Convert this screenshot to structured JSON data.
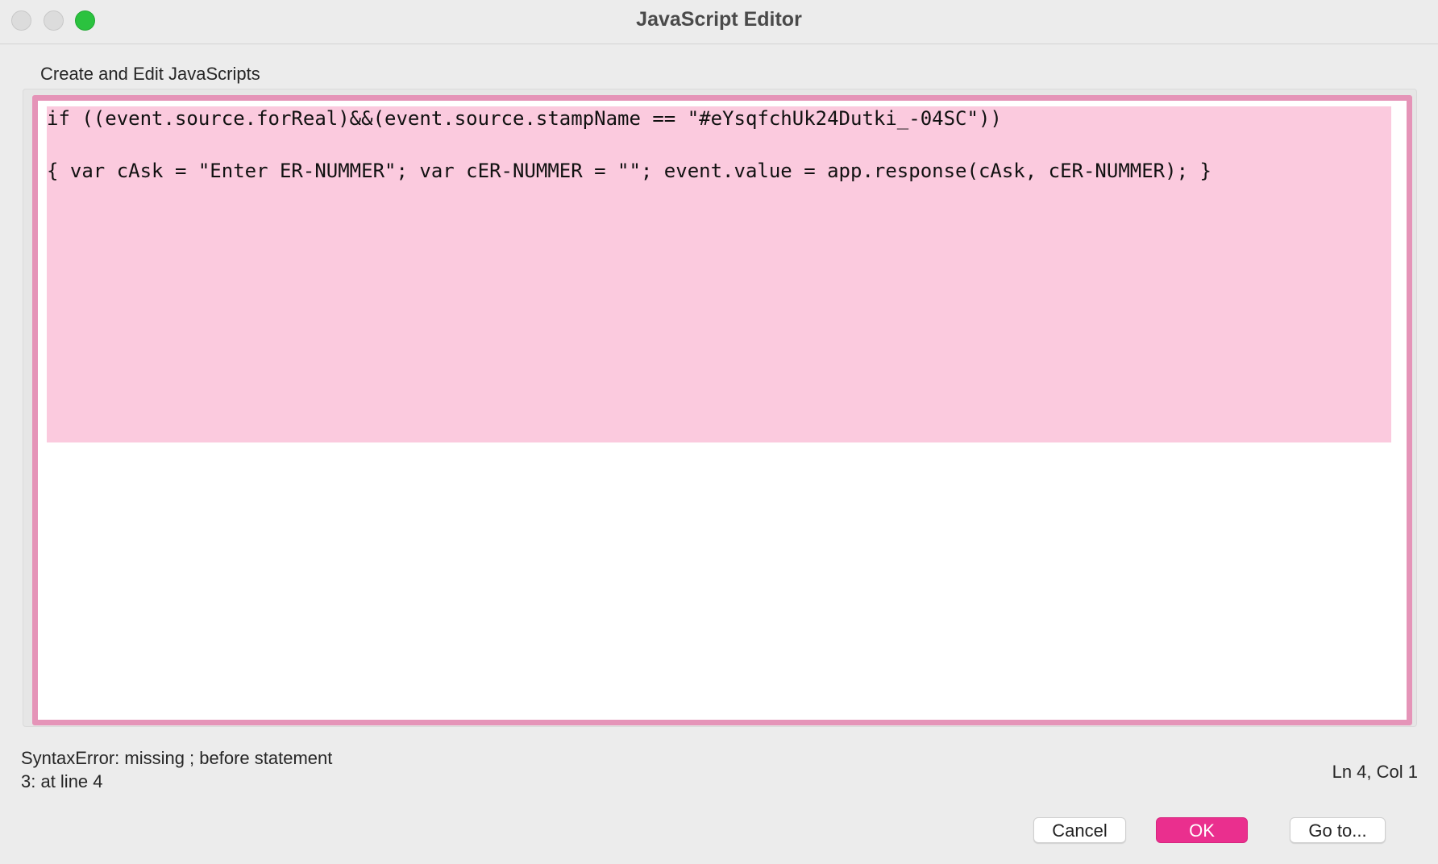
{
  "window": {
    "title": "JavaScript Editor"
  },
  "editor": {
    "section_label": "Create and Edit JavaScripts",
    "lines": [
      "if ((event.source.forReal)&&(event.source.stampName == \"#eYsqfchUk24Dutki_-04SC\"))",
      "{ var cAsk = \"Enter ER-NUMMER\"; var cER-NUMMER = \"\"; event.value = app.response(cAsk, cER-NUMMER); }"
    ],
    "selection_color": "#fbcade",
    "border_color": "#e594b8"
  },
  "status": {
    "error_message": "SyntaxError: missing ; before statement",
    "error_location": "3: at line 4",
    "cursor_position": "Ln 4, Col 1"
  },
  "buttons": {
    "cancel_label": "Cancel",
    "ok_label": "OK",
    "goto_label": "Go to..."
  },
  "colors": {
    "accent": "#ea2f8e",
    "zoom_button": "#2bc23f"
  }
}
